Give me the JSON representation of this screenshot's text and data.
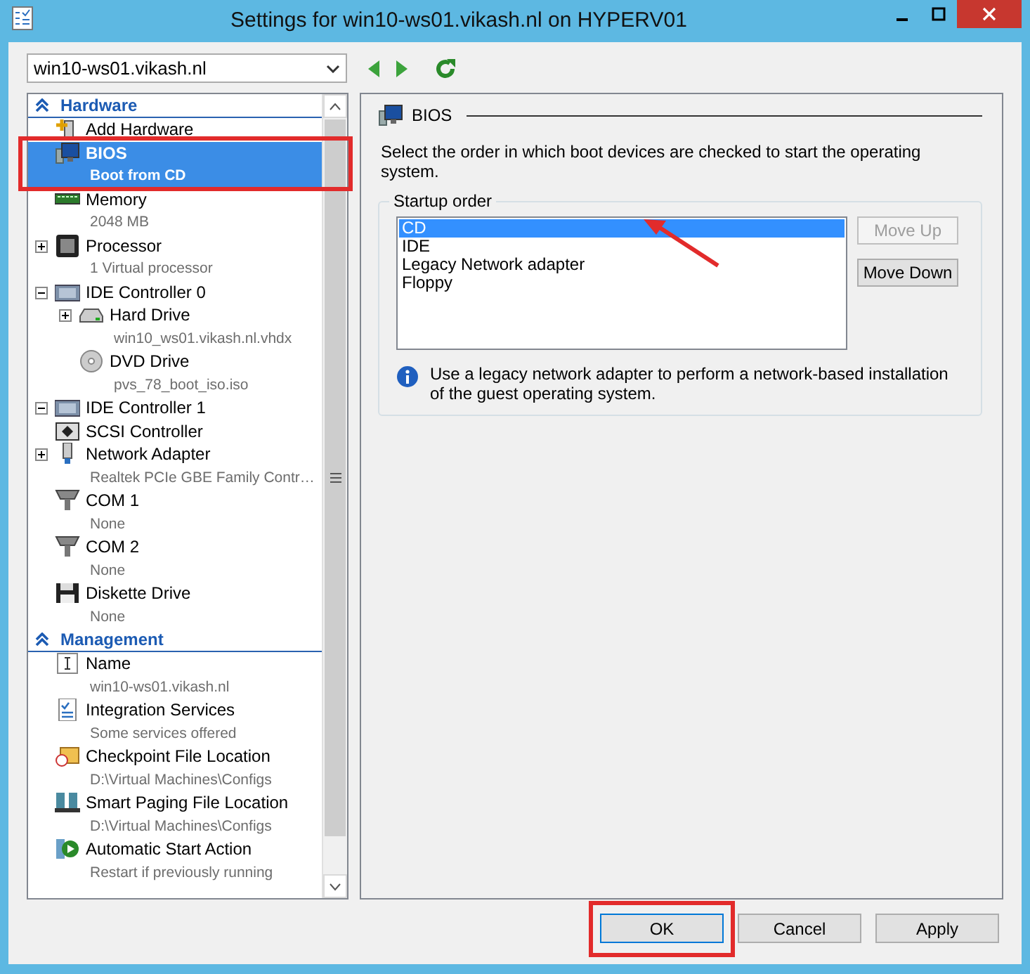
{
  "window": {
    "title": "Settings for win10-ws01.vikash.nl on HYPERV01"
  },
  "vm_selector": {
    "value": "win10-ws01.vikash.nl"
  },
  "tree": [
    {
      "kind": "header",
      "label": "Hardware",
      "expanded": true,
      "children": [
        {
          "label": "Add Hardware",
          "selected": false
        },
        {
          "label": "BIOS",
          "detail": "Boot from CD",
          "selected": true
        },
        {
          "label": "Memory",
          "detail": "2048 MB",
          "selected": false
        },
        {
          "label": "Processor",
          "detail": "1 Virtual processor",
          "selected": false,
          "expanded": false
        },
        {
          "label": "IDE Controller 0",
          "selected": false,
          "expanded": true,
          "children": [
            {
              "label": "Hard Drive",
              "detail": "win10_ws01.vikash.nl.vhdx",
              "selected": false,
              "expanded": false
            },
            {
              "label": "DVD Drive",
              "detail": "pvs_78_boot_iso.iso",
              "selected": false
            }
          ]
        },
        {
          "label": "IDE Controller 1",
          "selected": false,
          "expanded": true
        },
        {
          "label": "SCSI Controller",
          "selected": false
        },
        {
          "label": "Network Adapter",
          "detail": "Realtek PCIe GBE Family Contr…",
          "selected": false,
          "expanded": false
        },
        {
          "label": "COM 1",
          "detail": "None",
          "selected": false
        },
        {
          "label": "COM 2",
          "detail": "None",
          "selected": false
        },
        {
          "label": "Diskette Drive",
          "detail": "None",
          "selected": false
        }
      ]
    },
    {
      "kind": "header",
      "label": "Management",
      "expanded": true,
      "children": [
        {
          "label": "Name",
          "detail": "win10-ws01.vikash.nl",
          "selected": false
        },
        {
          "label": "Integration Services",
          "detail": "Some services offered",
          "selected": false
        },
        {
          "label": "Checkpoint File Location",
          "detail": "D:\\Virtual Machines\\Configs",
          "selected": false
        },
        {
          "label": "Smart Paging File Location",
          "detail": "D:\\Virtual Machines\\Configs",
          "selected": false
        },
        {
          "label": "Automatic Start Action",
          "detail": "Restart if previously running",
          "selected": false
        }
      ]
    }
  ],
  "panel": {
    "section_title": "BIOS",
    "description": "Select the order in which boot devices are checked to start the operating system.",
    "startup_order": {
      "title": "Startup order",
      "devices": [
        {
          "label": "CD",
          "selected": true
        },
        {
          "label": "IDE",
          "selected": false
        },
        {
          "label": "Legacy Network adapter",
          "selected": false
        },
        {
          "label": "Floppy",
          "selected": false
        }
      ],
      "buttons": [
        {
          "label": "Move Up",
          "disabled": true
        },
        {
          "label": "Move Down",
          "disabled": false
        }
      ],
      "note": "Use a legacy network adapter to perform a network-based installation of the guest operating system."
    }
  },
  "buttons": [
    {
      "label": "OK",
      "focused": true
    },
    {
      "label": "Cancel",
      "focused": false
    },
    {
      "label": "Apply",
      "focused": false
    }
  ]
}
